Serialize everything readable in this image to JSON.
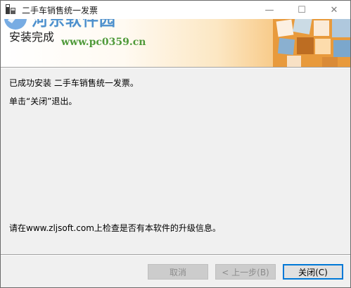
{
  "window": {
    "title": "二手车销售统一发票",
    "minimize_glyph": "—",
    "maximize_glyph": "☐",
    "close_glyph": "✕"
  },
  "banner": {
    "heading": "安装完成",
    "watermark_title": "河东软件园",
    "watermark_url": "www.pc0359.cn"
  },
  "content": {
    "line1": "已成功安装 二手车销售统一发票。",
    "line2": "单击“关闭”退出。",
    "line3": "请在www.zljsoft.com上检查是否有本软件的升级信息。"
  },
  "buttons": {
    "cancel": "取消",
    "back": "< 上一步(B)",
    "close": "关闭(C)"
  },
  "colors": {
    "accent": "#0078d7",
    "watermark_blue": "#3b86c9",
    "watermark_green": "#4f9a3a",
    "banner_orange": "#f1a94f"
  },
  "icons": {
    "app": "installer-app-icon",
    "logo": "pc0359-logo-icon",
    "banner_art": "installer-banner-art"
  }
}
